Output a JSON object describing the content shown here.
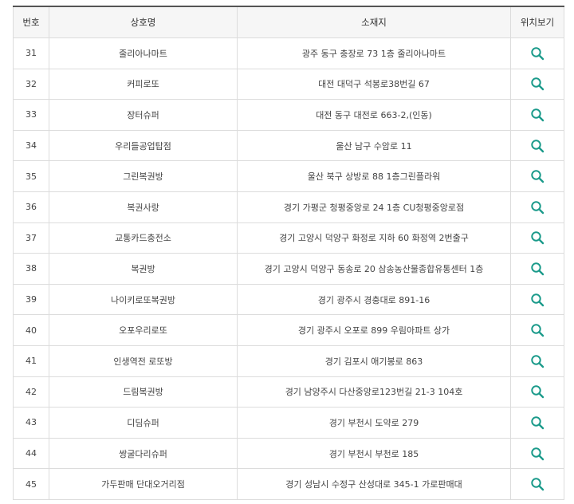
{
  "headers": [
    "번호",
    "상호명",
    "소재지",
    "위치보기"
  ],
  "accent_color": "#1a9a8a",
  "rows": [
    {
      "no": "31",
      "name": "줄리아나마트",
      "addr": "광주 동구 충장로 73 1층 줄리아나마트"
    },
    {
      "no": "32",
      "name": "커피로또",
      "addr": "대전 대덕구 석봉로38번길 67"
    },
    {
      "no": "33",
      "name": "장터슈퍼",
      "addr": "대전 동구 대전로 663-2,(인동)"
    },
    {
      "no": "34",
      "name": "우리들공업탑점",
      "addr": "울산 남구 수암로 11"
    },
    {
      "no": "35",
      "name": "그린복권방",
      "addr": "울산 북구 상방로 88 1층그린플라워"
    },
    {
      "no": "36",
      "name": "복권사랑",
      "addr": "경기 가평군 청평중앙로 24 1층 CU청평중앙로점"
    },
    {
      "no": "37",
      "name": "교통카드충전소",
      "addr": "경기 고양시 덕양구 화정로 지하 60 화정역 2번출구"
    },
    {
      "no": "38",
      "name": "복권방",
      "addr": "경기 고양시 덕양구 동송로 20 삼송농산물종합유통센터 1층"
    },
    {
      "no": "39",
      "name": "나이키로또복권방",
      "addr": "경기 광주시 경충대로 891-16"
    },
    {
      "no": "40",
      "name": "오포우리로또",
      "addr": "경기 광주시 오포로 899 우림아파트 상가"
    },
    {
      "no": "41",
      "name": "인생역전 로또방",
      "addr": "경기 김포시 애기봉로 863"
    },
    {
      "no": "42",
      "name": "드림복권방",
      "addr": "경기 남양주시 다산중앙로123번길 21-3 104호"
    },
    {
      "no": "43",
      "name": "디딤슈퍼",
      "addr": "경기 부천시 도약로 279"
    },
    {
      "no": "44",
      "name": "쌍굴다리슈퍼",
      "addr": "경기 부천시 부천로 185"
    },
    {
      "no": "45",
      "name": "가두판매 단대오거리점",
      "addr": "경기 성남시 수정구 산성대로 345-1 가로판매대"
    }
  ]
}
